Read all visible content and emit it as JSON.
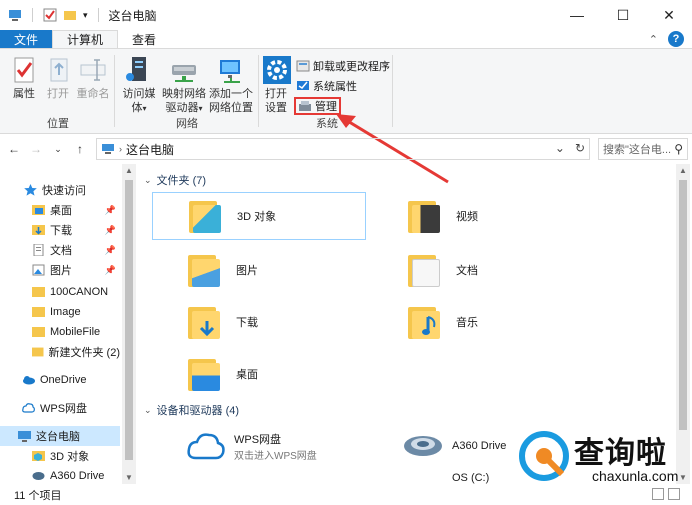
{
  "window": {
    "title": "这台电脑",
    "controls": {
      "minimize": "—",
      "maximize": "☐",
      "close": "✕"
    }
  },
  "ribbon_tabs": {
    "file": "文件",
    "computer": "计算机",
    "view": "查看",
    "help": "?"
  },
  "ribbon": {
    "location": {
      "label": "位置",
      "properties": "属性",
      "open": "打开",
      "rename": "重命名"
    },
    "network": {
      "label": "网络",
      "access_media": "访问媒体",
      "map_drive_1": "映射网络",
      "map_drive_2": "驱动器",
      "add_location_1": "添加一个",
      "add_location_2": "网络位置"
    },
    "system": {
      "label": "系统",
      "open_settings_1": "打开",
      "open_settings_2": "设置",
      "uninstall": "卸载或更改程序",
      "system_properties": "系统属性",
      "manage": "管理"
    }
  },
  "address": {
    "path": "这台电脑",
    "search_placeholder": "搜索\"这台电...",
    "refresh": "↻",
    "dropdown": "⌄"
  },
  "nav": {
    "quick_access": "快速访问",
    "items": [
      {
        "label": "桌面",
        "pinned": true
      },
      {
        "label": "下载",
        "pinned": true
      },
      {
        "label": "文档",
        "pinned": true
      },
      {
        "label": "图片",
        "pinned": true
      },
      {
        "label": "100CANON",
        "pinned": false
      },
      {
        "label": "Image",
        "pinned": false
      },
      {
        "label": "MobileFile",
        "pinned": false
      },
      {
        "label": "新建文件夹 (2)",
        "pinned": false
      }
    ],
    "onedrive": "OneDrive",
    "wps": "WPS网盘",
    "this_pc": "这台电脑",
    "objects_3d": "3D 对象",
    "a360": "A360 Drive"
  },
  "content": {
    "folders_header": "文件夹 (7)",
    "folders": [
      "3D 对象",
      "视频",
      "图片",
      "文档",
      "下载",
      "音乐",
      "桌面"
    ],
    "devices_header": "设备和驱动器 (4)",
    "devices": [
      {
        "name": "WPS网盘",
        "desc": "双击进入WPS网盘"
      },
      {
        "name": "A360 Drive",
        "desc": ""
      },
      {
        "name": "OS (C:)",
        "desc": ""
      }
    ]
  },
  "status": {
    "count": "11 个项目"
  },
  "watermark": {
    "brand": "查询啦",
    "domain": "chaxunla.com"
  },
  "colors": {
    "accent": "#1979ca",
    "highlight": "#e53935",
    "selection": "#cce8ff"
  }
}
